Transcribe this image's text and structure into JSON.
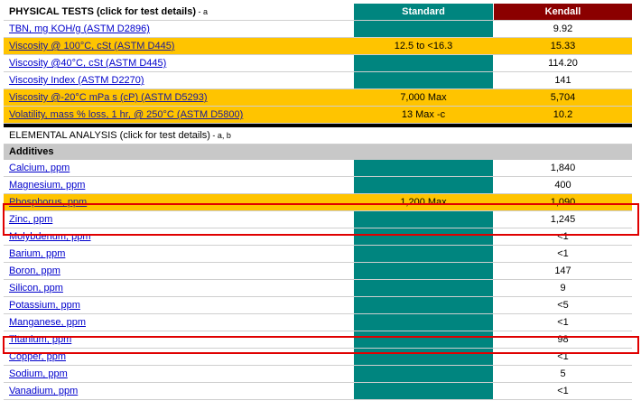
{
  "physical": {
    "title": "PHYSICAL TESTS (click for test details)",
    "note": " - a",
    "col_standard": "Standard",
    "col_kendall": "Kendall",
    "rows": [
      {
        "label": "TBN, mg KOH/g (ASTM D2896)",
        "standard": "",
        "value": "9.92",
        "highlight": false
      },
      {
        "label": "Viscosity @ 100°C, cSt (ASTM D445)",
        "standard": "12.5 to <16.3",
        "value": "15.33",
        "highlight": true
      },
      {
        "label": "Viscosity @40°C, cSt (ASTM D445)",
        "standard": "",
        "value": "114.20",
        "highlight": false
      },
      {
        "label": "Viscosity Index (ASTM D2270)",
        "standard": "",
        "value": "141",
        "highlight": false
      },
      {
        "label": "Viscosity @-20°C mPa s (cP) (ASTM D5293)",
        "standard": "7,000 Max",
        "value": "5,704",
        "highlight": true
      },
      {
        "label": "Volatility, mass % loss, 1 hr, @ 250°C (ASTM D5800)",
        "standard": "13 Max -c",
        "value": "10.2",
        "highlight": true
      }
    ]
  },
  "elemental": {
    "title": "ELEMENTAL ANALYSIS (click for test details)",
    "note": " - a, b",
    "subheading": "Additives",
    "rows": [
      {
        "label": "Calcium, ppm",
        "standard": "",
        "value": "1,840",
        "highlight": false
      },
      {
        "label": "Magnesium, ppm",
        "standard": "",
        "value": "400",
        "highlight": false
      },
      {
        "label": "Phosphorus, ppm",
        "standard": "1,200 Max",
        "value": "1,090",
        "highlight": true
      },
      {
        "label": "Zinc, ppm",
        "standard": "",
        "value": "1,245",
        "highlight": false
      },
      {
        "label": "Molybdenum,  ppm",
        "standard": "",
        "value": "<1",
        "highlight": false
      },
      {
        "label": "Barium, ppm",
        "standard": "",
        "value": "<1",
        "highlight": false
      },
      {
        "label": "Boron, ppm",
        "standard": "",
        "value": "147",
        "highlight": false
      },
      {
        "label": "Silicon, ppm",
        "standard": "",
        "value": "9",
        "highlight": false
      },
      {
        "label": "Potassium, ppm",
        "standard": "",
        "value": "<5",
        "highlight": false
      },
      {
        "label": "Manganese, ppm",
        "standard": "",
        "value": "<1",
        "highlight": false
      },
      {
        "label": "Titanium, ppm",
        "standard": "",
        "value": "98",
        "highlight": false
      },
      {
        "label": "Copper, ppm",
        "standard": "",
        "value": "<1",
        "highlight": false
      },
      {
        "label": "Sodium, ppm",
        "standard": "",
        "value": "5",
        "highlight": false
      },
      {
        "label": "Vanadium, ppm",
        "standard": "",
        "value": "<1",
        "highlight": false
      }
    ]
  },
  "colors": {
    "teal": "#00857f",
    "kendall_header": "#8b0000",
    "highlight_row": "#ffc400",
    "annotation_box": "#e00000"
  }
}
